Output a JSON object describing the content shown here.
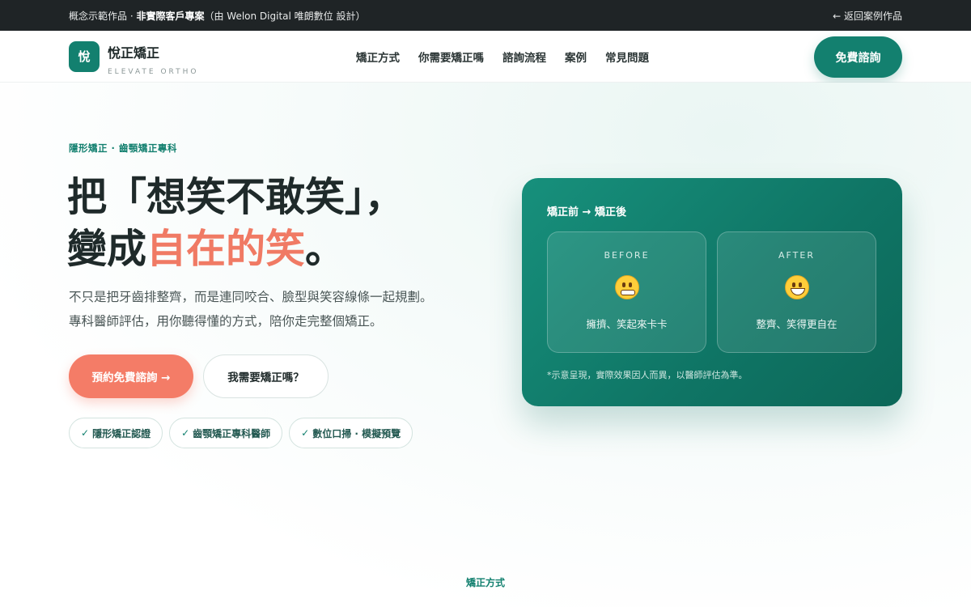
{
  "topbar": {
    "notice_prefix": "概念示範作品 · ",
    "notice_bold": "非實際客戶專案",
    "notice_suffix": "（由 Welon Digital 唯朗數位 設計）",
    "back_link": "← 返回案例作品"
  },
  "brand": {
    "mark": "悅",
    "name": "悅正矯正",
    "tagline": "ELEVATE ORTHO"
  },
  "nav": {
    "items": [
      "矯正方式",
      "你需要矯正嗎",
      "諮詢流程",
      "案例",
      "常見問題"
    ],
    "cta": "免費諮詢"
  },
  "hero": {
    "eyebrow": "隱形矯正 · 齒顎矯正專科",
    "headline_line1": "把「想笑不敢笑」，",
    "headline_line2_prefix": "變成",
    "headline_line2_accent": "自在的笑",
    "headline_line2_suffix": "。",
    "description": "不只是把牙齒排整齊，而是連同咬合、臉型與笑容線條一起規劃。專科醫師評估，用你聽得懂的方式，陪你走完整個矯正。",
    "primary_button": "預約免費諮詢 →",
    "secondary_button": "我需要矯正嗎？",
    "badges": [
      "隱形矯正認證",
      "齒顎矯正專科醫師",
      "數位口掃 · 模擬預覽"
    ],
    "badge_check": "✓"
  },
  "comparison_card": {
    "title": "矯正前 → 矯正後",
    "before": {
      "label": "BEFORE",
      "icon": "grimacing-face-icon",
      "caption": "擁擠、笑起來卡卡"
    },
    "after": {
      "label": "AFTER",
      "icon": "grinning-face-icon",
      "caption": "整齊、笑得更自在"
    },
    "note": "*示意呈現，實際效果因人而異，以醫師評估為準。"
  },
  "next_section": {
    "label": "矯正方式"
  },
  "colors": {
    "brand_green": "#13806f",
    "accent_coral": "#f47c67",
    "topbar_dark": "#1f2426"
  }
}
